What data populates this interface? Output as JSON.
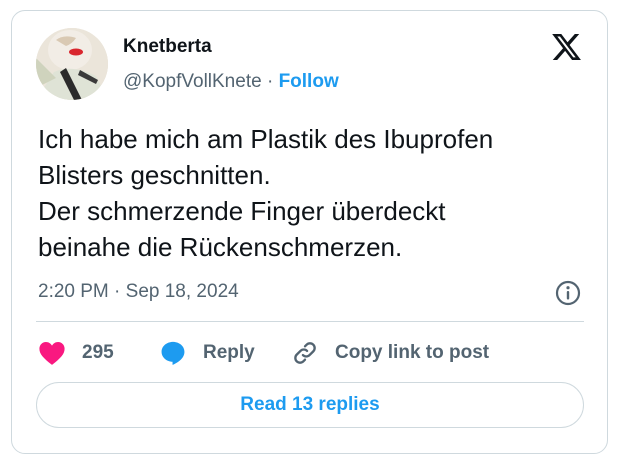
{
  "author": {
    "name": "Knetberta",
    "handle": "@KopfVollKnete",
    "separator": "·",
    "follow_label": "Follow"
  },
  "tweet": {
    "lines": [
      "Ich habe mich am Plastik des Ibuprofen",
      "Blisters geschnitten.",
      "Der schmerzende Finger überdeckt",
      "beinahe die Rückenschmerzen."
    ],
    "time": "2:20 PM",
    "dot": "·",
    "date": "Sep 18, 2024"
  },
  "actions": {
    "likes_count": "295",
    "reply_label": "Reply",
    "copy_label": "Copy link to post"
  },
  "read_replies_label": "Read 13 replies",
  "icons": {
    "logo": "x-logo-icon",
    "info": "info-icon",
    "like": "heart-icon",
    "reply": "speech-bubble-icon",
    "copy": "link-icon"
  },
  "colors": {
    "accent": "#1d9bf0",
    "like": "#f91880",
    "text": "#0f1419",
    "muted": "#536471",
    "border": "#cfd9de"
  }
}
